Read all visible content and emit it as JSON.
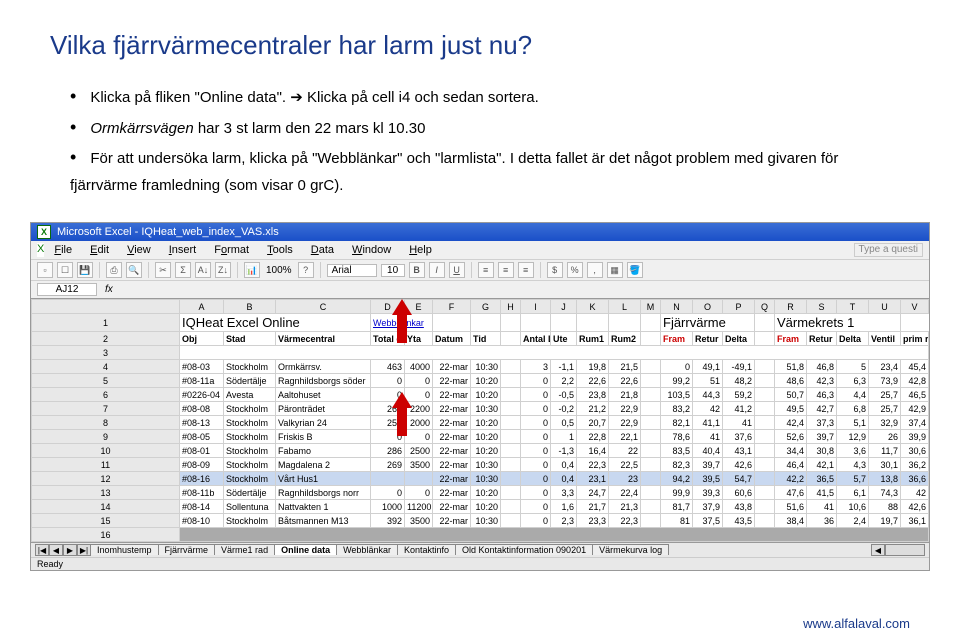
{
  "title": "Vilka fjärrvärmecentraler har larm just nu?",
  "bullets": {
    "b1a": "Klicka på fliken \"Online data\". ",
    "b1b": " Klicka på cell i4 och sedan sortera.",
    "b2a": "Ormkärrsvägen",
    "b2b": " har 3 st larm den 22 mars kl 10.30",
    "b3": "För att undersöka larm, klicka på \"Webblänkar\" och \"larmlista\". I detta fallet är det något problem med givaren för fjärrvärme framledning (som visar 0 grC)."
  },
  "excel": {
    "titlebar": "Microsoft Excel - IQHeat_web_index_VAS.xls",
    "menus": [
      "File",
      "Edit",
      "View",
      "Insert",
      "Format",
      "Tools",
      "Data",
      "Window",
      "Help"
    ],
    "helpbox": "Type a questi",
    "zoom": "100%",
    "font": "Arial",
    "size": "10",
    "cellref": "AJ12",
    "fx": "fx",
    "cols": [
      "",
      "A",
      "B",
      "C",
      "D",
      "E",
      "F",
      "G",
      "H",
      "I",
      "J",
      "K",
      "L",
      "M",
      "N",
      "O",
      "P",
      "Q",
      "R",
      "S",
      "T",
      "U",
      "V"
    ],
    "row1": {
      "a": "IQHeat Excel Online",
      "d": "Webb-länkar",
      "n": "Fjärrvärme",
      "r": "Värmekrets 1"
    },
    "row2": {
      "a": "Obj",
      "b": "Stad",
      "c": "Värmecentral",
      "d": "Total effekt",
      "e": "Yta",
      "f": "Datum",
      "g": "Tid",
      "i": "Antal Larm",
      "j": "Ute",
      "k": "Rum1",
      "l": "Rum2",
      "n": "Fram",
      "o": "Retur",
      "p": "Delta",
      "r": "Fram",
      "s": "Retur",
      "t": "Delta",
      "u": "Ventil",
      "v": "prim ret"
    },
    "rows": [
      {
        "n": "4",
        "a": "#08-03",
        "b": "Stockholm",
        "c": "Ormkärrsv.",
        "d": "463",
        "e": "4000",
        "f": "22-mar",
        "g": "10:30",
        "h": "",
        "i": "3",
        "j": "-1,1",
        "k": "19,8",
        "l": "21,5",
        "m": "",
        "nC": "0",
        "o": "49,1",
        "p": "-49,1",
        "q": "",
        "r": "51,8",
        "s": "46,8",
        "t": "5",
        "u": "23,4",
        "v": "45,4"
      },
      {
        "n": "5",
        "a": "#08-11a",
        "b": "Södertälje",
        "c": "Ragnhildsborgs söder",
        "d": "0",
        "e": "0",
        "f": "22-mar",
        "g": "10:20",
        "h": "",
        "i": "0",
        "j": "2,2",
        "k": "22,6",
        "l": "22,6",
        "m": "",
        "nC": "99,2",
        "o": "51",
        "p": "48,2",
        "q": "",
        "r": "48,6",
        "s": "42,3",
        "t": "6,3",
        "u": "73,9",
        "v": "42,8"
      },
      {
        "n": "6",
        "a": "#0226-04",
        "b": "Avesta",
        "c": "Aaltohuset",
        "d": "0",
        "e": "0",
        "f": "22-mar",
        "g": "10:20",
        "h": "",
        "i": "0",
        "j": "-0,5",
        "k": "23,8",
        "l": "21,8",
        "m": "",
        "nC": "103,5",
        "o": "44,3",
        "p": "59,2",
        "q": "",
        "r": "50,7",
        "s": "46,3",
        "t": "4,4",
        "u": "25,7",
        "v": "46,5"
      },
      {
        "n": "7",
        "a": "#08-08",
        "b": "Stockholm",
        "c": "Päronträdet",
        "d": "262",
        "e": "2200",
        "f": "22-mar",
        "g": "10:30",
        "h": "",
        "i": "0",
        "j": "-0,2",
        "k": "21,2",
        "l": "22,9",
        "m": "",
        "nC": "83,2",
        "o": "42",
        "p": "41,2",
        "q": "",
        "r": "49,5",
        "s": "42,7",
        "t": "6,8",
        "u": "25,7",
        "v": "42,9"
      },
      {
        "n": "8",
        "a": "#08-13",
        "b": "Stockholm",
        "c": "Valkyrian 24",
        "d": "250",
        "e": "2000",
        "f": "22-mar",
        "g": "10:20",
        "h": "",
        "i": "0",
        "j": "0,5",
        "k": "20,7",
        "l": "22,9",
        "m": "",
        "nC": "82,1",
        "o": "41,1",
        "p": "41",
        "q": "",
        "r": "42,4",
        "s": "37,3",
        "t": "5,1",
        "u": "32,9",
        "v": "37,4"
      },
      {
        "n": "9",
        "a": "#08-05",
        "b": "Stockholm",
        "c": "Friskis B",
        "d": "0",
        "e": "0",
        "f": "22-mar",
        "g": "10:20",
        "h": "",
        "i": "0",
        "j": "1",
        "k": "22,8",
        "l": "22,1",
        "m": "",
        "nC": "78,6",
        "o": "41",
        "p": "37,6",
        "q": "",
        "r": "52,6",
        "s": "39,7",
        "t": "12,9",
        "u": "26",
        "v": "39,9"
      },
      {
        "n": "10",
        "a": "#08-01",
        "b": "Stockholm",
        "c": "Fabamo",
        "d": "286",
        "e": "2500",
        "f": "22-mar",
        "g": "10:20",
        "h": "",
        "i": "0",
        "j": "-1,3",
        "k": "16,4",
        "l": "22",
        "m": "",
        "nC": "83,5",
        "o": "40,4",
        "p": "43,1",
        "q": "",
        "r": "34,4",
        "s": "30,8",
        "t": "3,6",
        "u": "11,7",
        "v": "30,6"
      },
      {
        "n": "11",
        "a": "#08-09",
        "b": "Stockholm",
        "c": "Magdalena 2",
        "d": "269",
        "e": "3500",
        "f": "22-mar",
        "g": "10:30",
        "h": "",
        "i": "0",
        "j": "0,4",
        "k": "22,3",
        "l": "22,5",
        "m": "",
        "nC": "82,3",
        "o": "39,7",
        "p": "42,6",
        "q": "",
        "r": "46,4",
        "s": "42,1",
        "t": "4,3",
        "u": "30,1",
        "v": "36,2"
      },
      {
        "n": "12",
        "a": "#08-16",
        "b": "Stockholm",
        "c": "Vårt Hus1",
        "d": "",
        "e": "",
        "f": "22-mar",
        "g": "10:30",
        "h": "",
        "i": "0",
        "j": "0,4",
        "k": "23,1",
        "l": "23",
        "m": "",
        "nC": "94,2",
        "o": "39,5",
        "p": "54,7",
        "q": "",
        "r": "42,2",
        "s": "36,5",
        "t": "5,7",
        "u": "13,8",
        "v": "36,6"
      },
      {
        "n": "13",
        "a": "#08-11b",
        "b": "Södertälje",
        "c": "Ragnhildsborgs norr",
        "d": "0",
        "e": "0",
        "f": "22-mar",
        "g": "10:20",
        "h": "",
        "i": "0",
        "j": "3,3",
        "k": "24,7",
        "l": "22,4",
        "m": "",
        "nC": "99,9",
        "o": "39,3",
        "p": "60,6",
        "q": "",
        "r": "47,6",
        "s": "41,5",
        "t": "6,1",
        "u": "74,3",
        "v": "42"
      },
      {
        "n": "14",
        "a": "#08-14",
        "b": "Sollentuna",
        "c": "Nattvakten 1",
        "d": "1000",
        "e": "11200",
        "f": "22-mar",
        "g": "10:20",
        "h": "",
        "i": "0",
        "j": "1,6",
        "k": "21,7",
        "l": "21,3",
        "m": "",
        "nC": "81,7",
        "o": "37,9",
        "p": "43,8",
        "q": "",
        "r": "51,6",
        "s": "41",
        "t": "10,6",
        "u": "88",
        "v": "42,6"
      },
      {
        "n": "15",
        "a": "#08-10",
        "b": "Stockholm",
        "c": "Båtsmannen M13",
        "d": "392",
        "e": "3500",
        "f": "22-mar",
        "g": "10:30",
        "h": "",
        "i": "0",
        "j": "2,3",
        "k": "23,3",
        "l": "22,3",
        "m": "",
        "nC": "81",
        "o": "37,5",
        "p": "43,5",
        "q": "",
        "r": "38,4",
        "s": "36",
        "t": "2,4",
        "u": "19,7",
        "v": "36,1"
      }
    ],
    "tabs": [
      "Inomhustemp",
      "Fjärrvärme",
      "Värme1 rad",
      "Online data",
      "Webblänkar",
      "Kontaktinfo",
      "Old Kontaktinformation 090201",
      "Värmekurva log"
    ],
    "activeTab": 3,
    "status": "Ready"
  },
  "footer": "www.alfalaval.com"
}
